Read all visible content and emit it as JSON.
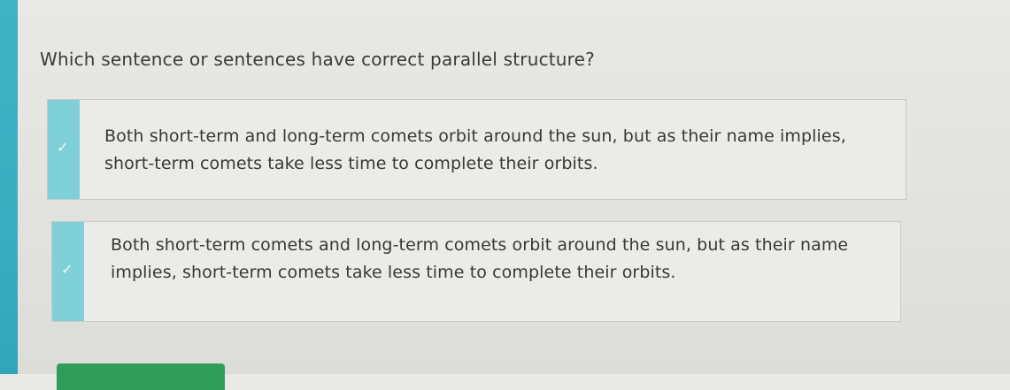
{
  "question": {
    "text": "Which sentence or sentences have correct parallel structure?"
  },
  "answers": [
    {
      "text": "Both short-term and long-term comets orbit around the sun, but as their name implies, short-term comets take less time to complete their orbits.",
      "selected": true,
      "icon": "checkmark-icon"
    },
    {
      "text": "Both short-term comets and long-term comets orbit around the sun, but as their name implies, short-term comets take less time to complete their orbits.",
      "selected": true,
      "icon": "checkmark-icon"
    }
  ],
  "colors": {
    "accent": "#7fd0d9",
    "edge": "#3aaec0",
    "submit": "#2f9c5a"
  }
}
